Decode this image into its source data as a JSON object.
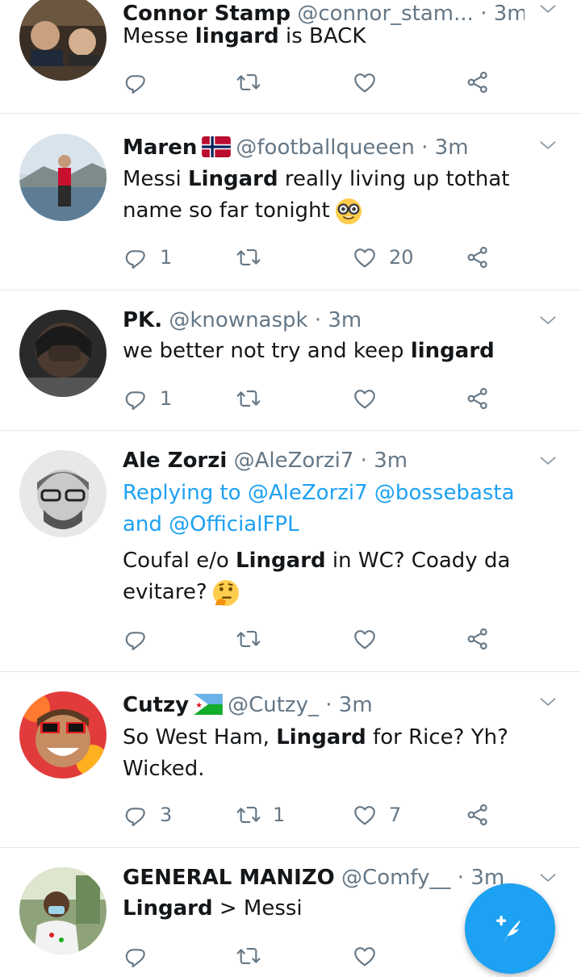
{
  "tweets": [
    {
      "name": "Connor Stamp",
      "handle": "@connor_stam...",
      "dot_time": "· 3m",
      "text_parts": [
        {
          "t": "Messe ",
          "b": false
        },
        {
          "t": "lingard",
          "b": true
        },
        {
          "t": " is BACK",
          "b": false
        }
      ],
      "replies": "",
      "retweets": "",
      "likes": ""
    },
    {
      "name": "Maren",
      "flag_icon": "norway-flag-icon",
      "handle": "@footballqueeen",
      "dot_time": "· 3m",
      "text_parts": [
        {
          "t": "Messi ",
          "b": false
        },
        {
          "t": "Lingard",
          "b": true
        },
        {
          "t": " really living up tothat name so far tonight",
          "b": false
        }
      ],
      "emoji_icon": "nerd-face-emoji-icon",
      "replies": "1",
      "retweets": "",
      "likes": "20"
    },
    {
      "name": "PK.",
      "handle": "@knownaspk",
      "dot_time": "· 3m",
      "text_parts": [
        {
          "t": "we better not try and keep ",
          "b": false
        },
        {
          "t": "lingard",
          "b": true
        }
      ],
      "replies": "1",
      "retweets": "",
      "likes": ""
    },
    {
      "name": "Ale Zorzi",
      "handle": "@AleZorzi7",
      "dot_time": "· 3m",
      "reply_line1": "Replying to @AleZorzi7 @bossebasta",
      "reply_line2": "and @OfficialFPL",
      "text_parts": [
        {
          "t": "Coufal e/o ",
          "b": false
        },
        {
          "t": "Lingard",
          "b": true
        },
        {
          "t": " in WC? Coady da evitare?",
          "b": false
        }
      ],
      "emoji_icon": "thinking-face-emoji-icon",
      "replies": "",
      "retweets": "",
      "likes": ""
    },
    {
      "name": "Cutzy",
      "flag_icon": "djibouti-flag-icon",
      "handle": "@Cutzy_",
      "dot_time": "· 3m",
      "text_parts": [
        {
          "t": "So West Ham, ",
          "b": false
        },
        {
          "t": "Lingard",
          "b": true
        },
        {
          "t": " for Rice? Yh? Wicked.",
          "b": false
        }
      ],
      "replies": "3",
      "retweets": "1",
      "likes": "7"
    },
    {
      "name": "GENERAL MANIZO",
      "handle": "@Comfy__",
      "dot_time": "· 3m",
      "text_parts": [
        {
          "t": "Lingard",
          "b": true
        },
        {
          "t": " > Messi",
          "b": false
        }
      ],
      "replies": "",
      "retweets": "",
      "likes": ""
    }
  ],
  "fab": {
    "icon": "compose-tweet-icon"
  },
  "colors": {
    "accent": "#1da1f2",
    "secondary_text": "#657786",
    "divider": "#e1e8ed"
  }
}
